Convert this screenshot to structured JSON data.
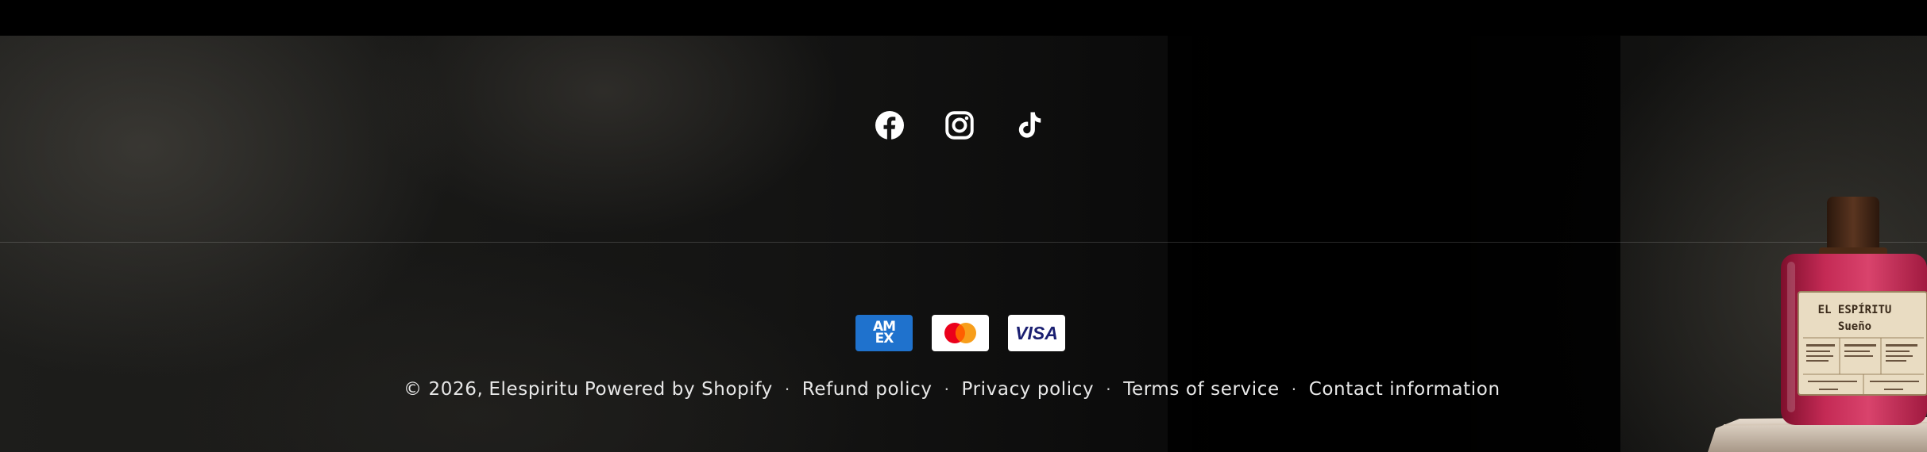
{
  "social": [
    {
      "name": "Facebook",
      "icon": "facebook-icon"
    },
    {
      "name": "Instagram",
      "icon": "instagram-icon"
    },
    {
      "name": "TikTok",
      "icon": "tiktok-icon"
    }
  ],
  "payments": {
    "amex": {
      "label_line1": "AM",
      "label_line2": "EX",
      "color": "#1f72cd"
    },
    "mastercard": {
      "colors": [
        "#eb001b",
        "#f79e1b",
        "#ff5f00"
      ]
    },
    "visa": {
      "label": "VISA",
      "color": "#1a1f71"
    }
  },
  "footer": {
    "copyright": "© 2026,",
    "brand": "Elespiritu",
    "powered_by": "Powered by Shopify",
    "separator": "·",
    "links": [
      "Refund policy",
      "Privacy policy",
      "Terms of service",
      "Contact information"
    ]
  },
  "product": {
    "label_brand": "EL ESPÍRITU",
    "label_name": "Sueño",
    "colors": {
      "glass": "#c0244e",
      "cap": "#3b2416",
      "label": "#e9dcc2"
    }
  }
}
